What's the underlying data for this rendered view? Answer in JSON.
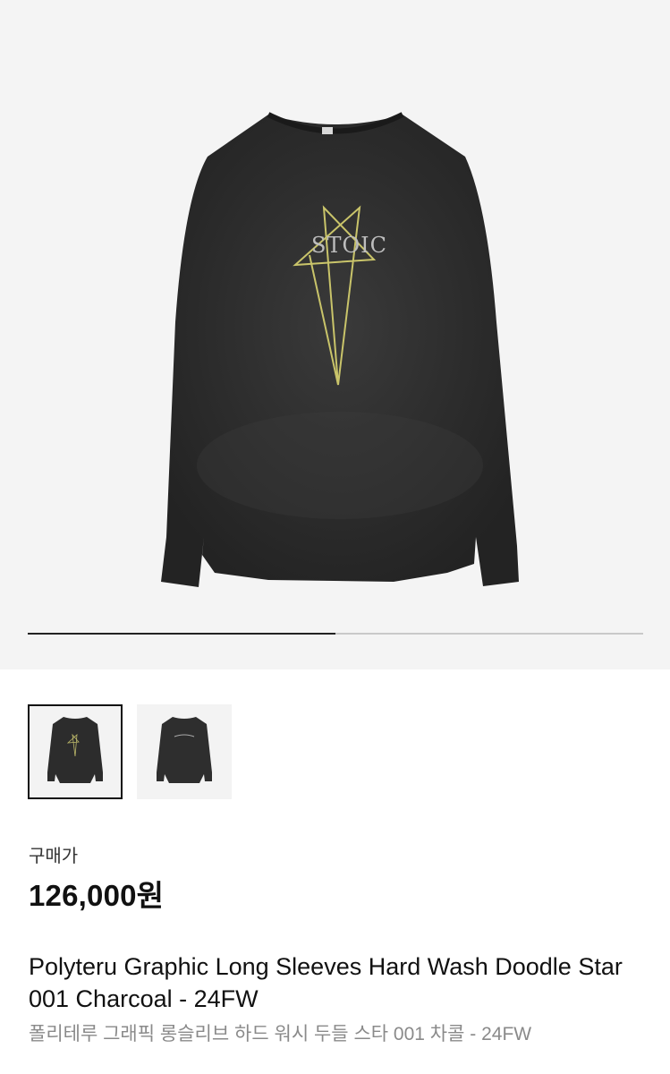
{
  "gallery": {
    "progress_fraction": 0.5,
    "thumbnails": [
      {
        "icon": "shirt-front-image",
        "selected": true
      },
      {
        "icon": "shirt-back-image",
        "selected": false
      }
    ],
    "graphic_text": "STOIC"
  },
  "product": {
    "price_label": "구매가",
    "price": "126,000원",
    "title_en": "Polyteru Graphic Long Sleeves Hard Wash Doodle Star 001 Charcoal - 24FW",
    "title_ko": "폴리테루 그래픽 롱슬리브 하드 워시 두들 스타 001 차콜 - 24FW"
  }
}
